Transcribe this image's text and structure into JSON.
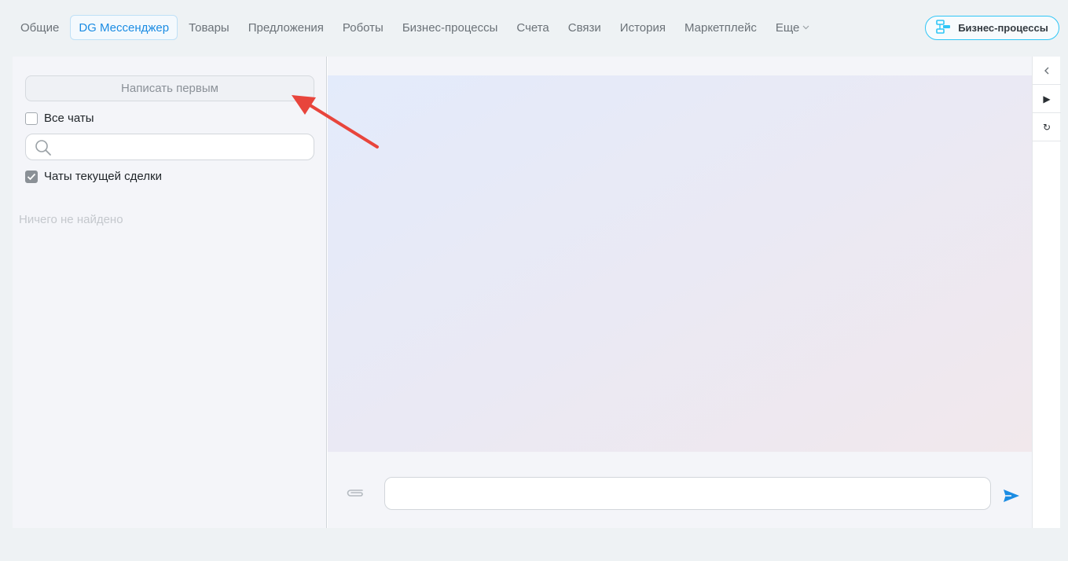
{
  "tabs": [
    {
      "label": "Общие"
    },
    {
      "label": "DG Мессенджер",
      "active": true
    },
    {
      "label": "Товары"
    },
    {
      "label": "Предложения"
    },
    {
      "label": "Роботы"
    },
    {
      "label": "Бизнес-процессы"
    },
    {
      "label": "Счета"
    },
    {
      "label": "Связи"
    },
    {
      "label": "История"
    },
    {
      "label": "Маркетплейс"
    },
    {
      "label": "Еще"
    }
  ],
  "header": {
    "bp_button_label": "Бизнес-процессы"
  },
  "left_panel": {
    "write_first_label": "Написать первым",
    "all_chats_label": "Все чаты",
    "all_chats_checked": false,
    "search_placeholder": "",
    "current_deal_chats_label": "Чаты текущей сделки",
    "current_deal_chats_checked": true,
    "empty_note": "Ничего не найдено"
  },
  "chat": {
    "message_placeholder": ""
  },
  "right_rail": {
    "buttons": [
      {
        "icon": "chevron-left-icon",
        "glyph": "‹"
      },
      {
        "icon": "play-icon",
        "glyph": "▶"
      },
      {
        "icon": "refresh-icon",
        "glyph": "↻"
      }
    ]
  },
  "colors": {
    "accent": "#1b8ce3",
    "bp_border": "#2fc6f6",
    "send_icon": "#1b8ce3",
    "annotation_arrow": "#e8453c"
  }
}
